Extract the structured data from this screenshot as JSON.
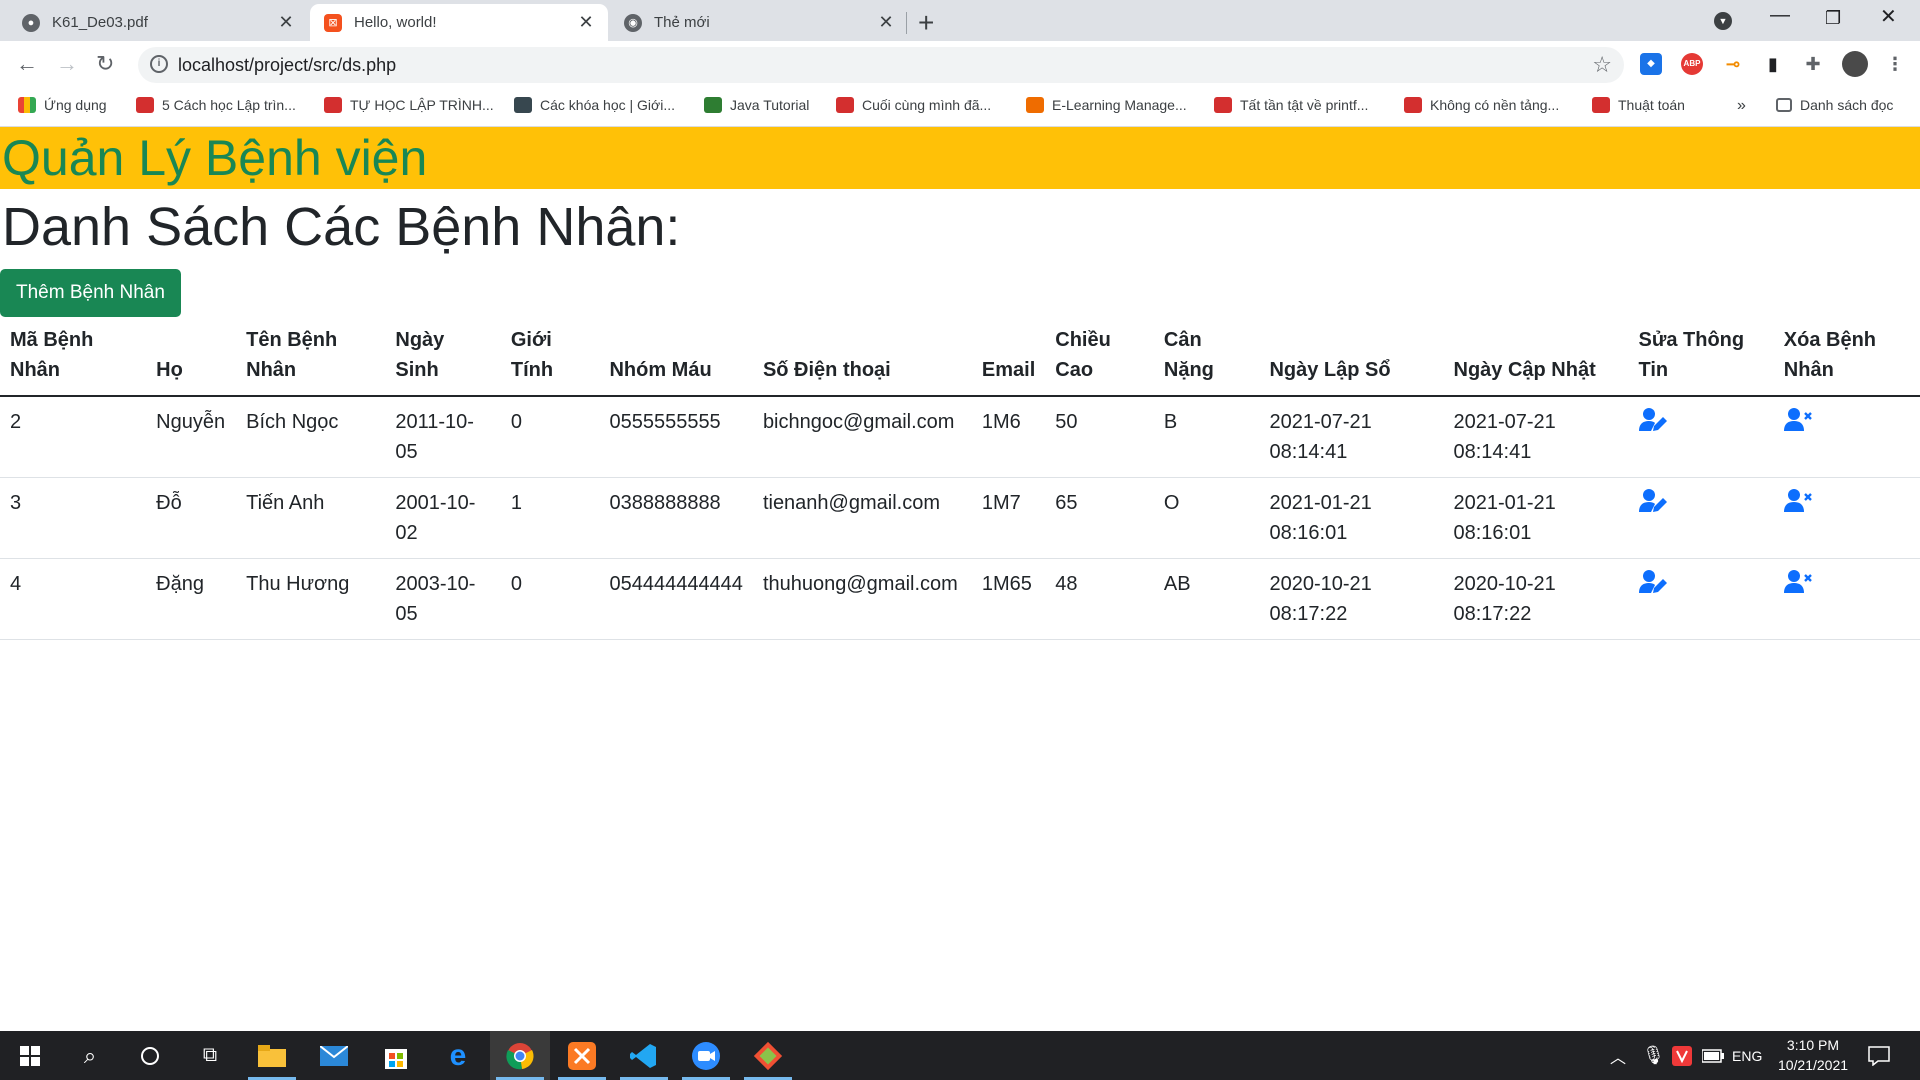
{
  "browser": {
    "tabs": [
      {
        "title": "K61_De03.pdf",
        "active": false
      },
      {
        "title": "Hello, world!",
        "active": true
      },
      {
        "title": "Thẻ mới",
        "active": false
      }
    ],
    "url": "localhost/project/src/ds.php",
    "bookmarks": [
      {
        "label": "Ứng dụng",
        "icon": "apps-grid-icon"
      },
      {
        "label": "5 Cách học Lập trìn...",
        "icon": "bookmark-site-icon"
      },
      {
        "label": "TỰ HỌC LẬP TRÌNH...",
        "icon": "bookmark-site-icon"
      },
      {
        "label": "Các khóa học | Giới...",
        "icon": "bookmark-site-icon"
      },
      {
        "label": "Java Tutorial",
        "icon": "bookmark-site-icon"
      },
      {
        "label": "Cuối cùng mình đã...",
        "icon": "bookmark-site-icon"
      },
      {
        "label": "E-Learning Manage...",
        "icon": "bookmark-site-icon"
      },
      {
        "label": "Tất tần tật về printf...",
        "icon": "bookmark-site-icon"
      },
      {
        "label": "Không có nền tảng...",
        "icon": "bookmark-site-icon"
      },
      {
        "label": "Thuật toán",
        "icon": "bookmark-site-icon"
      }
    ],
    "bookmarks_more": "»",
    "reading_list": "Danh sách đọc"
  },
  "page": {
    "app_title": "Quản Lý Bệnh viện",
    "list_title": "Danh Sách Các Bệnh Nhân:",
    "add_button": "Thêm Bệnh Nhân",
    "table": {
      "headers": [
        "Mã Bệnh Nhân",
        "Họ",
        "Tên Bệnh Nhân",
        "Ngày Sinh",
        "Giới Tính",
        "Nhóm Máu",
        "Số Điện thoại",
        "Email",
        "Chiều Cao",
        "Cân Nặng",
        "Ngày Lập Sổ",
        "Ngày Cập Nhật",
        "Sửa Thông Tin",
        "Xóa Bệnh Nhân"
      ],
      "rows": [
        [
          "2",
          "Nguyễn",
          "Bích Ngọc",
          "2011-10-05",
          "0",
          "0555555555",
          "bichngoc@gmail.com",
          "1M6",
          "50",
          "B",
          "2021-07-21 08:14:41",
          "2021-07-21 08:14:41"
        ],
        [
          "3",
          "Đỗ",
          "Tiến Anh",
          "2001-10-02",
          "1",
          "0388888888",
          "tienanh@gmail.com",
          "1M7",
          "65",
          "O",
          "2021-01-21 08:16:01",
          "2021-01-21 08:16:01"
        ],
        [
          "4",
          "Đặng",
          "Thu Hương",
          "2003-10-05",
          "0",
          "054444444444",
          "thuhuong@gmail.com",
          "1M65",
          "48",
          "AB",
          "2020-10-21 08:17:22",
          "2020-10-21 08:17:22"
        ]
      ],
      "edit_icon": "user-edit-icon",
      "delete_icon": "user-delete-icon"
    }
  },
  "taskbar": {
    "language": "ENG",
    "time": "3:10 PM",
    "date": "10/21/2021"
  },
  "colors": {
    "header_bg": "#ffc107",
    "title_green": "#198754",
    "action_blue": "#0d6efd"
  }
}
